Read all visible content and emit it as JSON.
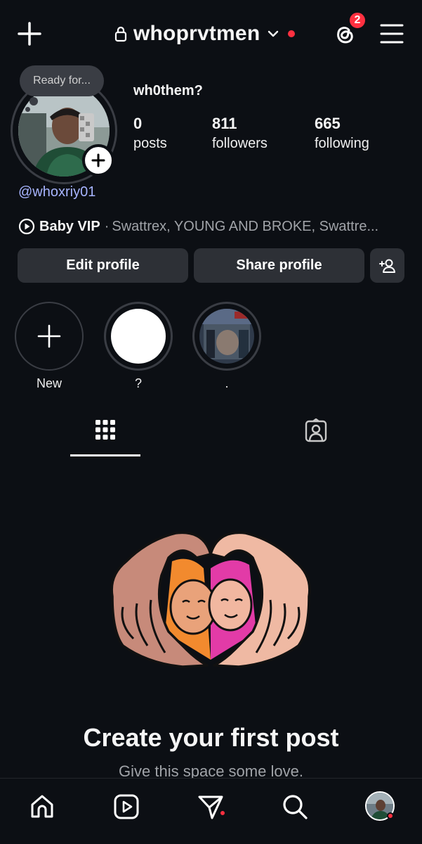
{
  "header": {
    "username": "whoprvtmen",
    "notification_count": "2"
  },
  "note": {
    "text": "Ready for..."
  },
  "profile": {
    "display_name": "wh0them?",
    "threads_handle": "@whoxriy01",
    "stats": [
      {
        "value": "0",
        "label": "posts"
      },
      {
        "value": "811",
        "label": "followers"
      },
      {
        "value": "665",
        "label": "following"
      }
    ],
    "music": {
      "title": "Baby VIP",
      "separator": "·",
      "artists": "Swattrex, YOUNG AND BROKE, Swattre..."
    }
  },
  "buttons": {
    "edit_profile": "Edit profile",
    "share_profile": "Share profile"
  },
  "highlights": [
    {
      "label": "New"
    },
    {
      "label": "?"
    },
    {
      "label": "."
    }
  ],
  "empty_state": {
    "title": "Create your first post",
    "subtitle": "Give this space some love."
  },
  "colors": {
    "background": "#0c0f14",
    "button_bg": "#2d3036",
    "accent_red": "#ff3040",
    "link": "#a7b4ff"
  }
}
